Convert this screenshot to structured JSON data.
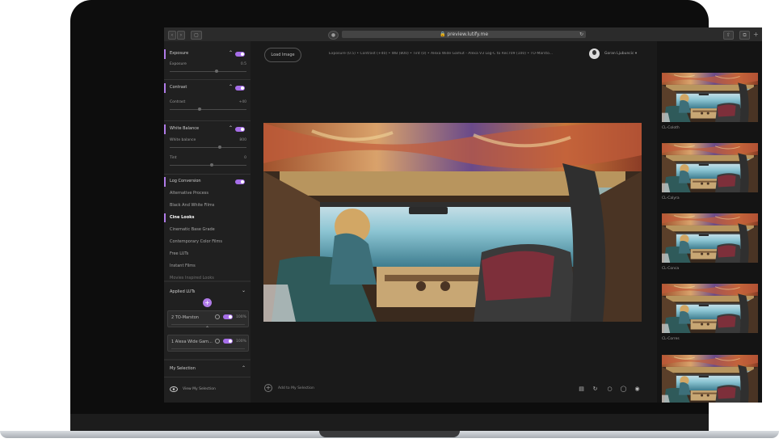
{
  "browser": {
    "url": "preview.lutify.me"
  },
  "adjustments": {
    "exposure": {
      "title": "Exposure",
      "label": "Exposure",
      "value": "0.5",
      "level": 0.62
    },
    "contrast": {
      "title": "Contrast",
      "label": "Contrast",
      "value": "+40",
      "level": 0.38
    },
    "white_balance": {
      "title": "White Balance",
      "label": "White balance",
      "value": "800",
      "level": 0.66,
      "tint_label": "Tint",
      "tint_value": "0",
      "tint_level": 0.55
    }
  },
  "log_conversion": {
    "title": "Log Conversion"
  },
  "categories": [
    "Alternative Process",
    "Black And White Films",
    "Cine Looks",
    "Cinematic Base Grade",
    "Contemporary Color Films",
    "Free LUTs",
    "Instant Films",
    "Movies Inspired Looks"
  ],
  "active_category": "Cine Looks",
  "applied_luts": {
    "title": "Applied LUTs",
    "items": [
      {
        "name": "2  TO-Marston",
        "percent": "100%"
      },
      {
        "name": "1  Alexa Wide Gam...",
        "percent": "100%"
      }
    ]
  },
  "my_selection": {
    "title": "My Selection",
    "view_label": "View My Selection"
  },
  "toolbar": {
    "load_image": "Load Image",
    "recipe": "Exposure (0.5) • Contrast (+40) • WB (800) • Tint (0) • Alexa Wide Gamut - Alexa V3 Log-C to Rec709 (100) • TO-Marsto...",
    "user_name": "Goran Ljubuncic ▾",
    "add_selection": "Add to My Selection"
  },
  "thumbnails": [
    {
      "label": "CL-Coloth"
    },
    {
      "label": "CL-Calyra"
    },
    {
      "label": "CL-Conca"
    },
    {
      "label": "CL-Corres"
    },
    {
      "label": ""
    }
  ],
  "icons": {
    "browser": [
      "chevron-left-icon",
      "chevron-right-icon",
      "sidebar-icon",
      "shield-icon",
      "lock-icon",
      "reload-icon",
      "share-icon",
      "tabs-icon",
      "plus-icon"
    ],
    "bottom_tools": [
      "compare-icon",
      "rotate-icon",
      "circle-icon",
      "toggle-view-icon",
      "eye-icon"
    ]
  },
  "colors": {
    "accent": "#b07be8",
    "panel": "#202020",
    "background": "#1a1a1a"
  }
}
